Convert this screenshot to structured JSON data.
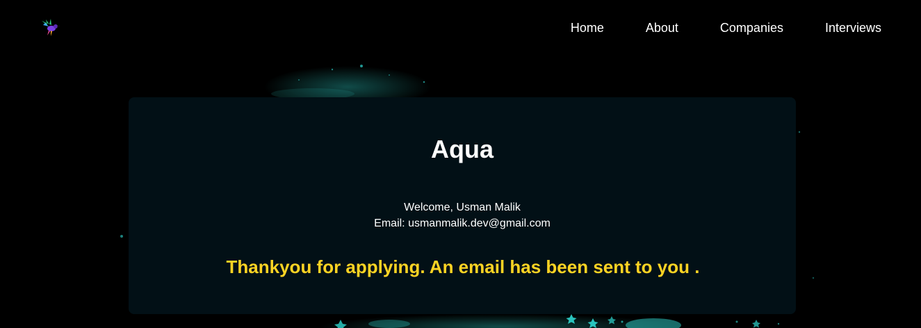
{
  "nav": {
    "items": [
      {
        "label": "Home"
      },
      {
        "label": "About"
      },
      {
        "label": "Companies"
      },
      {
        "label": "Interviews"
      }
    ]
  },
  "card": {
    "title": "Aqua",
    "welcome": "Welcome, Usman Malik",
    "email": "Email: usmanmalik.dev@gmail.com",
    "confirmation": "Thankyou for applying. An email has been sent to you ."
  },
  "colors": {
    "background": "#000000",
    "card_background": "#021016",
    "accent": "#FDD323",
    "sparkle": "#2fd6cf"
  },
  "icons": {
    "logo": "hummingbird-icon"
  }
}
